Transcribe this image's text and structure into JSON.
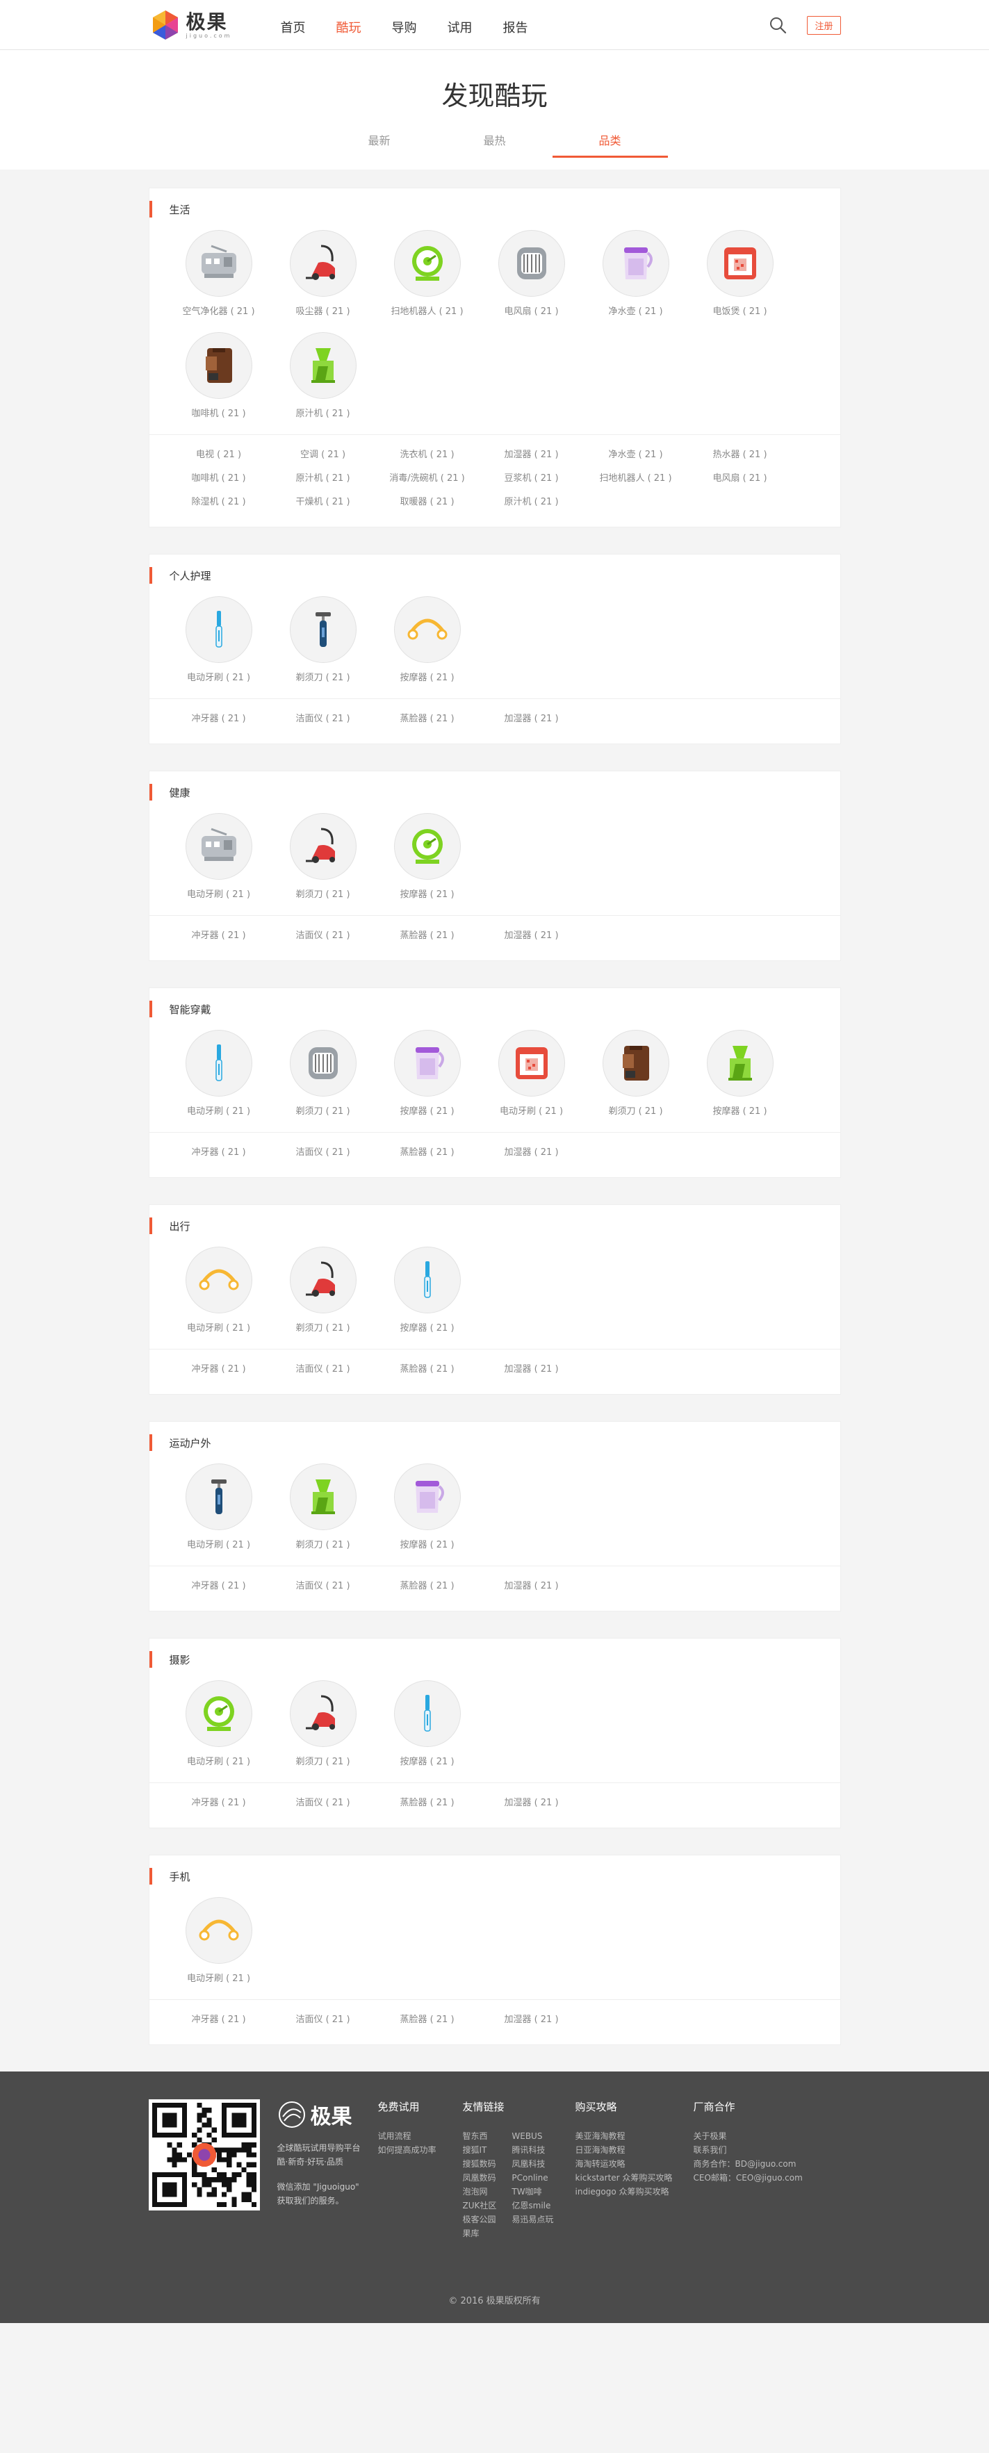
{
  "header": {
    "logo_cn": "极果",
    "logo_en": "jiguo.com",
    "nav": [
      "首页",
      "酷玩",
      "导购",
      "试用",
      "报告"
    ],
    "active_nav": 1,
    "register_label": "注册"
  },
  "hero": {
    "title": "发现酷玩",
    "tabs": [
      "最新",
      "最热",
      "品类"
    ],
    "active_tab": 2
  },
  "categories": [
    {
      "title": "生活",
      "items": [
        {
          "icon": "air-purifier-icon",
          "label": "空气净化器 ( 21 )"
        },
        {
          "icon": "vacuum-cleaner-icon",
          "label": "吸尘器 ( 21 )"
        },
        {
          "icon": "robot-vacuum-icon",
          "label": "扫地机器人 ( 21 )"
        },
        {
          "icon": "heater-fan-icon",
          "label": "电风扇 ( 21 )"
        },
        {
          "icon": "water-pitcher-icon",
          "label": "净水壶 ( 21 )"
        },
        {
          "icon": "rice-cooker-icon",
          "label": "电饭煲 ( 21 )"
        },
        {
          "icon": "coffee-machine-icon",
          "label": "咖啡机 ( 21 )"
        },
        {
          "icon": "juicer-icon",
          "label": "原汁机 ( 21 )"
        }
      ],
      "links": [
        "电视 ( 21 )",
        "空调 ( 21 )",
        "洗衣机 ( 21 )",
        "加湿器 ( 21 )",
        "净水壶 ( 21 )",
        "热水器 ( 21 )",
        "咖啡机 ( 21 )",
        "原汁机 ( 21 )",
        "消毒/洗碗机 ( 21 )",
        "豆浆机 ( 21 )",
        "扫地机器人 ( 21 )",
        "电风扇 ( 21 )",
        "除湿机 ( 21 )",
        "干燥机 ( 21 )",
        "取暖器 ( 21 )",
        "原汁机 ( 21 )"
      ]
    },
    {
      "title": "个人护理",
      "items": [
        {
          "icon": "toothbrush-icon",
          "label": "电动牙刷 ( 21 )"
        },
        {
          "icon": "razor-icon",
          "label": "剃须刀 ( 21 )"
        },
        {
          "icon": "massager-icon",
          "label": "按摩器 ( 21 )"
        }
      ],
      "links": [
        "冲牙器 ( 21 )",
        "洁面仪 ( 21 )",
        "蒸脸器 ( 21 )",
        "加湿器 ( 21 )"
      ]
    },
    {
      "title": "健康",
      "items": [
        {
          "icon": "air-purifier-icon",
          "label": "电动牙刷 ( 21 )"
        },
        {
          "icon": "vacuum-cleaner-icon",
          "label": "剃须刀 ( 21 )"
        },
        {
          "icon": "robot-vacuum-icon",
          "label": "按摩器 ( 21 )"
        }
      ],
      "links": [
        "冲牙器 ( 21 )",
        "洁面仪 ( 21 )",
        "蒸脸器 ( 21 )",
        "加湿器 ( 21 )"
      ]
    },
    {
      "title": "智能穿戴",
      "items": [
        {
          "icon": "toothbrush-icon",
          "label": "电动牙刷 ( 21 )"
        },
        {
          "icon": "heater-fan-icon",
          "label": "剃须刀 ( 21 )"
        },
        {
          "icon": "water-pitcher-icon",
          "label": "按摩器 ( 21 )"
        },
        {
          "icon": "rice-cooker-icon",
          "label": "电动牙刷 ( 21 )"
        },
        {
          "icon": "coffee-machine-icon",
          "label": "剃须刀 ( 21 )"
        },
        {
          "icon": "juicer-icon",
          "label": "按摩器 ( 21 )"
        }
      ],
      "links": [
        "冲牙器 ( 21 )",
        "洁面仪 ( 21 )",
        "蒸脸器 ( 21 )",
        "加湿器 ( 21 )"
      ]
    },
    {
      "title": "出行",
      "items": [
        {
          "icon": "massager-icon",
          "label": "电动牙刷 ( 21 )"
        },
        {
          "icon": "vacuum-cleaner-icon",
          "label": "剃须刀 ( 21 )"
        },
        {
          "icon": "toothbrush-icon",
          "label": "按摩器 ( 21 )"
        }
      ],
      "links": [
        "冲牙器 ( 21 )",
        "洁面仪 ( 21 )",
        "蒸脸器 ( 21 )",
        "加湿器 ( 21 )"
      ]
    },
    {
      "title": "运动户外",
      "items": [
        {
          "icon": "razor-icon",
          "label": "电动牙刷 ( 21 )"
        },
        {
          "icon": "juicer-icon",
          "label": "剃须刀 ( 21 )"
        },
        {
          "icon": "water-pitcher-icon",
          "label": "按摩器 ( 21 )"
        }
      ],
      "links": [
        "冲牙器 ( 21 )",
        "洁面仪 ( 21 )",
        "蒸脸器 ( 21 )",
        "加湿器 ( 21 )"
      ]
    },
    {
      "title": "摄影",
      "items": [
        {
          "icon": "robot-vacuum-icon",
          "label": "电动牙刷 ( 21 )"
        },
        {
          "icon": "vacuum-cleaner-icon",
          "label": "剃须刀 ( 21 )"
        },
        {
          "icon": "toothbrush-icon",
          "label": "按摩器 ( 21 )"
        }
      ],
      "links": [
        "冲牙器 ( 21 )",
        "洁面仪 ( 21 )",
        "蒸脸器 ( 21 )",
        "加湿器 ( 21 )"
      ]
    },
    {
      "title": "手机",
      "items": [
        {
          "icon": "massager-icon",
          "label": "电动牙刷 ( 21 )"
        }
      ],
      "links": [
        "冲牙器 ( 21 )",
        "洁面仪 ( 21 )",
        "蒸脸器 ( 21 )",
        "加湿器 ( 21 )"
      ]
    }
  ],
  "footer": {
    "brand_cn": "极果",
    "brand_en": "jiguo.com",
    "tagline1": "全球酷玩试用导购平台",
    "tagline2": "酷·新奇·好玩·品质",
    "wechat1": "微信添加 \"Jiguoiguo\"",
    "wechat2": "获取我们的服务。",
    "columns": [
      {
        "title": "免费试用",
        "lines": [
          "试用流程",
          "如何提高成功率"
        ]
      },
      {
        "title": "友情链接",
        "lines": [
          "智东西",
          "搜狐IT",
          "搜狐数码",
          "凤凰数码",
          "泡泡网",
          "ZUK社区",
          "极客公园",
          "果库"
        ],
        "lines2": [
          "WEBUS",
          "腾讯科技",
          "凤凰科技",
          "PConline",
          "TW咖啡",
          "亿恩smile",
          "易迅易点玩"
        ]
      },
      {
        "title": "购买攻略",
        "lines": [
          "美亚海淘教程",
          "日亚海淘教程",
          "海淘转运攻略",
          "kickstarter 众筹购买攻略",
          "indiegogo 众筹购买攻略"
        ]
      },
      {
        "title": "厂商合作",
        "lines": [
          "关于极果",
          "联系我们",
          "商务合作：BD@jiguo.com",
          "CEO邮箱：CEO@jiguo.com"
        ]
      }
    ],
    "copyright": "© 2016 极果版权所有"
  }
}
